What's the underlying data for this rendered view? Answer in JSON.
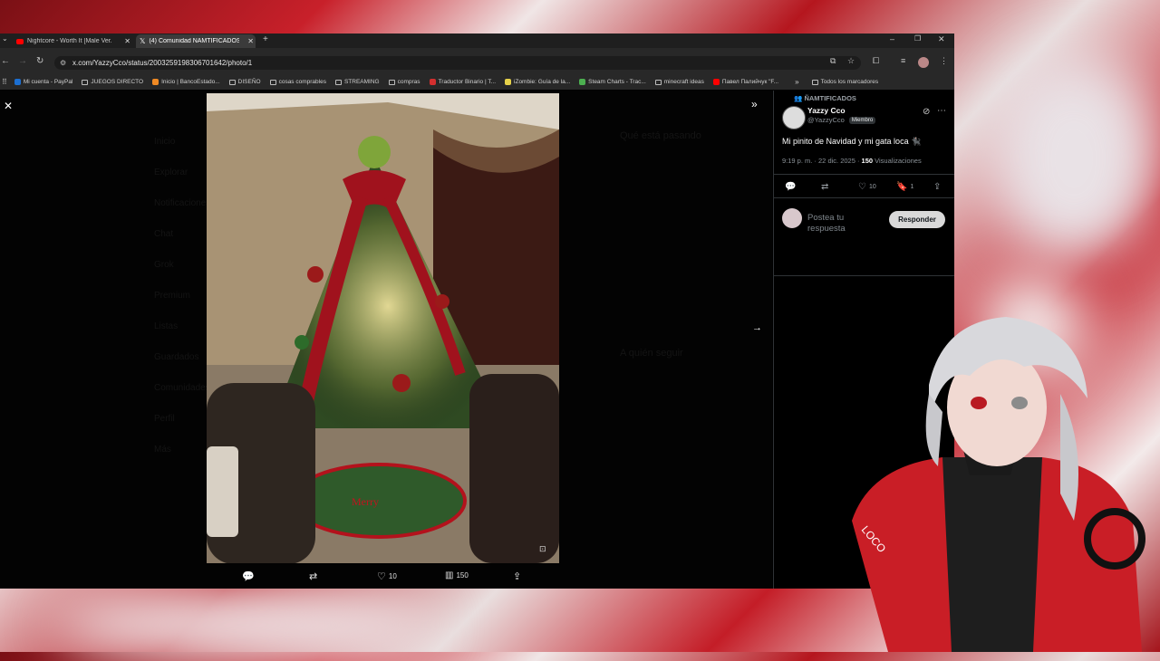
{
  "tabs": [
    {
      "title": "Nightcore - Worth It [Male Ver.",
      "icon": "youtube-icon"
    },
    {
      "title": "(4) Comunidad ÑAMTIFICADOS",
      "icon": "x-logo-icon"
    }
  ],
  "address": {
    "url": "x.com/YazzyCco/status/2003259198306701642/photo/1"
  },
  "bookmarks": [
    {
      "label": "Mi cuenta - PayPal",
      "icon": "paypal-icon"
    },
    {
      "label": "JUEGOS DIRECTO",
      "icon": "folder-icon"
    },
    {
      "label": "Inicio | BancoEstado...",
      "icon": "bank-icon"
    },
    {
      "label": "DISEÑO",
      "icon": "folder-icon"
    },
    {
      "label": "cosas comprables",
      "icon": "folder-icon"
    },
    {
      "label": "STREAMING",
      "icon": "folder-icon"
    },
    {
      "label": "compras",
      "icon": "folder-icon"
    },
    {
      "label": "Traductor Binario | T...",
      "icon": "binary-icon"
    },
    {
      "label": "iZombie: Guía de la...",
      "icon": "fandom-icon"
    },
    {
      "label": "Steam Charts - Trac...",
      "icon": "steamcharts-icon"
    },
    {
      "label": "minecraft ideas",
      "icon": "folder-icon"
    },
    {
      "label": "Павел Палийчук \"F...",
      "icon": "youtube-icon"
    }
  ],
  "bookmarks_all": "Todos los marcadores",
  "post": {
    "community": "ÑAMTIFICADOS",
    "author_name": "Yazzy Cco",
    "author_handle": "@YazzyCco",
    "member_badge": "Miembro",
    "text": "Mi pinito de Navidad y mi gata loca 🐈‍⬛",
    "time": "9:19 p. m. · 22 dic. 2025 · ",
    "views_count": "150",
    "views_label": " Visualizaciones",
    "likes": "10",
    "bookmarks": "1",
    "reply_placeholder": "Postea tu respuesta",
    "reply_button": "Responder"
  },
  "photo_actions": {
    "likes": "10",
    "views": "150"
  },
  "colors": {
    "accent": "#e0242e",
    "panel_bg": "#000000"
  }
}
